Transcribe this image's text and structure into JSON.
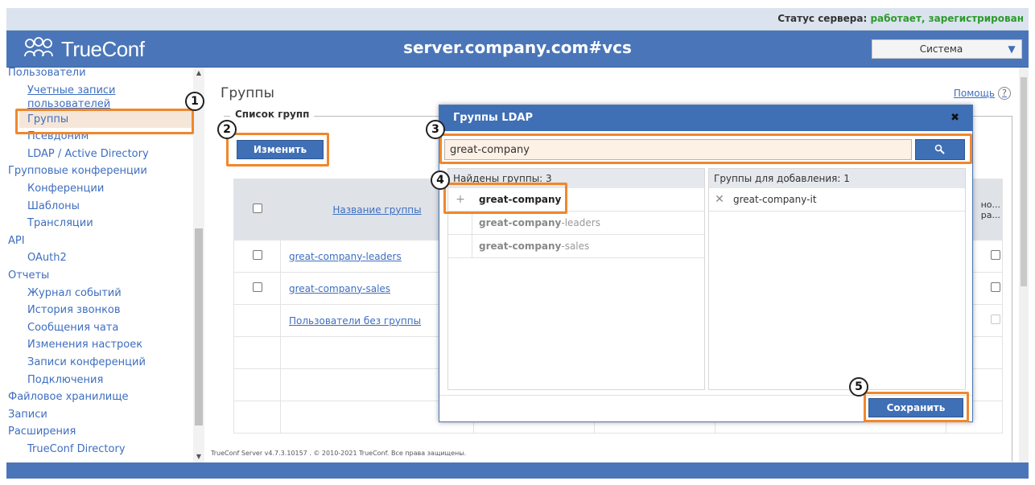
{
  "status": {
    "label": "Статус сервера: ",
    "value": "работает, зарегистрирован"
  },
  "header": {
    "logo_text": "TrueConf",
    "server_name": "server.company.com#vcs",
    "system_select": "Система"
  },
  "sidebar": {
    "items": [
      {
        "label": "Пользователи",
        "level": 1
      },
      {
        "label": "Учетные записи пользователей",
        "level": 2
      },
      {
        "label": "Группы",
        "level": 2,
        "active": true
      },
      {
        "label": "Псевдоним",
        "level": 2
      },
      {
        "label": "LDAP / Active Directory",
        "level": 2
      },
      {
        "label": "Групповые конференции",
        "level": 1
      },
      {
        "label": "Конференции",
        "level": 2
      },
      {
        "label": "Шаблоны",
        "level": 2
      },
      {
        "label": "Трансляции",
        "level": 2
      },
      {
        "label": "API",
        "level": 1
      },
      {
        "label": "OAuth2",
        "level": 2
      },
      {
        "label": "Отчеты",
        "level": 1
      },
      {
        "label": "Журнал событий",
        "level": 2
      },
      {
        "label": "История звонков",
        "level": 2
      },
      {
        "label": "Сообщения чата",
        "level": 2
      },
      {
        "label": "Изменения настроек",
        "level": 2
      },
      {
        "label": "Записи конференций",
        "level": 2
      },
      {
        "label": "Подключения",
        "level": 2
      },
      {
        "label": "Файловое хранилище",
        "level": 1
      },
      {
        "label": "Записи",
        "level": 1
      },
      {
        "label": "Расширения",
        "level": 1
      },
      {
        "label": "TrueConf Directory",
        "level": 2
      }
    ]
  },
  "main": {
    "title": "Группы",
    "help": "Помощь",
    "help_icon": "?",
    "section_legend": "Список групп",
    "edit_button": "Изменить",
    "table": {
      "header_name": "Название группы",
      "rows": [
        "great-company-leaders",
        "great-company-sales"
      ],
      "no_group_link": "Пользователи без группы",
      "clipped_right_header": [
        "но...",
        "ра..."
      ]
    },
    "footer": "TrueConf Server v4.7.3.10157 . © 2010-2021 TrueConf. Все права защищены."
  },
  "modal": {
    "title": "Группы LDAP",
    "close": "✖",
    "search_value": "great-company",
    "found_label": "Найдены группы: 3",
    "found": [
      {
        "prefix": "great-company",
        "suffix": ""
      },
      {
        "prefix": "great-company",
        "suffix": "-leaders"
      },
      {
        "prefix": "great-company",
        "suffix": "-sales"
      }
    ],
    "to_add_label": "Группы для добавления: 1",
    "to_add": [
      "great-company-it"
    ],
    "save_button": "Сохранить"
  },
  "annotations": [
    "1",
    "2",
    "3",
    "4",
    "5"
  ],
  "colors": {
    "header": "#4a76b9",
    "accent": "#3f6fb5",
    "highlight": "#f0872c",
    "status_ok": "#2d9a2d"
  }
}
